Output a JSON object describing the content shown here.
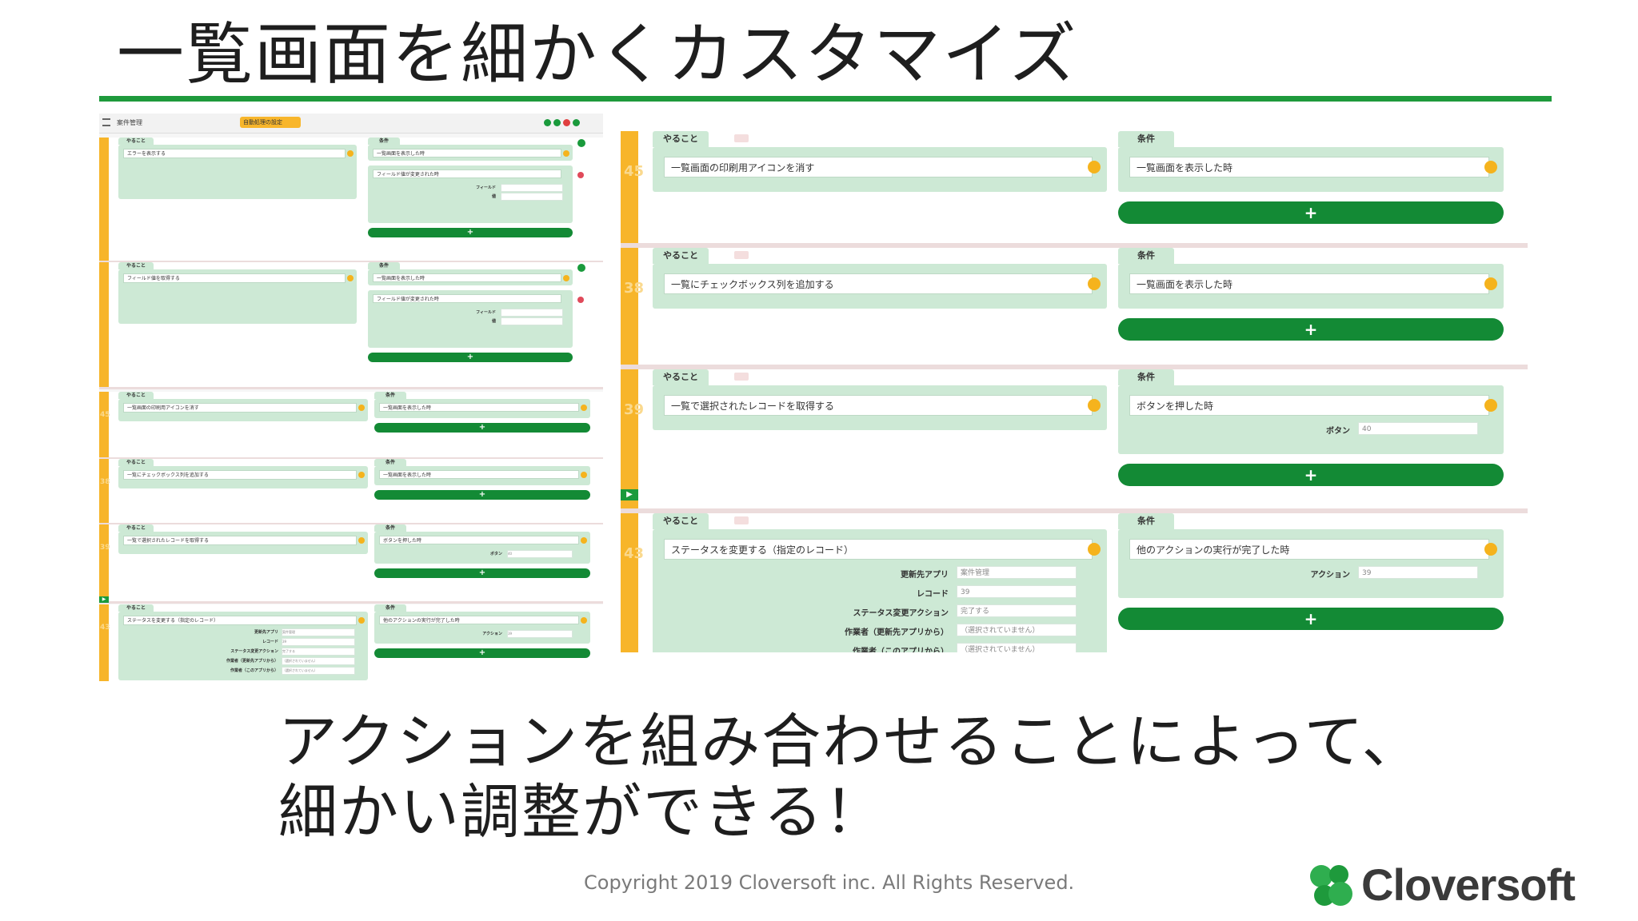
{
  "slide": {
    "title": "一覧画面を細かくカスタマイズ",
    "caption_line1": "アクションを組み合わせることによって、",
    "caption_line2": "細かい調整ができる！",
    "copyright": "Copyright 2019 Cloversoft inc. All Rights Reserved.",
    "brand": "Cloversoft"
  },
  "colors": {
    "accent_green": "#1e9a3c",
    "button_green": "#138a35",
    "card_green": "#cde9d5",
    "row_bar": "#f7b52a"
  },
  "labels": {
    "todo": "やること",
    "condition": "条件",
    "add": "+"
  },
  "large": {
    "rows": [
      {
        "num": "45",
        "action": "一覧画面の印刷用アイコンを消す",
        "condition": "一覧画面を表示した時",
        "action_fields": [],
        "condition_fields": []
      },
      {
        "num": "38",
        "action": "一覧にチェックボックス列を追加する",
        "condition": "一覧画面を表示した時",
        "action_fields": [],
        "condition_fields": []
      },
      {
        "num": "39",
        "action": "一覧で選択されたレコードを取得する",
        "condition": "ボタンを押した時",
        "action_fields": [],
        "condition_fields": [
          {
            "label": "ボタン",
            "value": "40"
          }
        ]
      },
      {
        "num": "43",
        "action": "ステータスを変更する（指定のレコード）",
        "condition": "他のアクションの実行が完了した時",
        "action_fields": [
          {
            "label": "更新先アプリ",
            "value": "案件管理"
          },
          {
            "label": "レコード",
            "value": "39"
          },
          {
            "label": "ステータス変更アクション",
            "value": "完了する"
          },
          {
            "label": "作業者（更新先アプリから）",
            "value": "（選択されていません）"
          },
          {
            "label": "作業者（このアプリから）",
            "value": "（選択されていません）"
          }
        ],
        "condition_fields": [
          {
            "label": "アクション",
            "value": "39"
          }
        ]
      }
    ]
  },
  "small": {
    "toolbar": {
      "app_name": "案件管理",
      "menu_button": "自動処理の設定"
    },
    "rows": [
      {
        "num": "",
        "action": "エラーを表示する",
        "condition": "一覧画面を表示した時",
        "condition2": "フィールド値が変更された時",
        "fields": [
          {
            "label": "フィールド",
            "value": ""
          },
          {
            "label": "値",
            "value": ""
          }
        ]
      },
      {
        "num": "",
        "action": "フィールド値を取得する",
        "condition": "一覧画面を表示した時",
        "condition2": "フィールド値が変更された時",
        "fields": [
          {
            "label": "フィールド",
            "value": ""
          },
          {
            "label": "値",
            "value": ""
          }
        ]
      },
      {
        "num": "45",
        "action": "一覧画面の印刷用アイコンを消す",
        "condition": "一覧画面を表示した時"
      },
      {
        "num": "38",
        "action": "一覧にチェックボックス列を追加する",
        "condition": "一覧画面を表示した時"
      },
      {
        "num": "39",
        "action": "一覧で選択されたレコードを取得する",
        "condition": "ボタンを押した時",
        "cfield": {
          "label": "ボタン",
          "value": "40"
        }
      },
      {
        "num": "43",
        "action": "ステータスを変更する（指定のレコード）",
        "condition": "他のアクションの実行が完了した時",
        "cfield": {
          "label": "アクション",
          "value": "39"
        },
        "fields": [
          {
            "label": "更新先アプリ",
            "value": "案件管理"
          },
          {
            "label": "レコード",
            "value": "39"
          },
          {
            "label": "ステータス変更アクション",
            "value": "完了する"
          },
          {
            "label": "作業者（更新先アプリから）",
            "value": "（選択されていません）"
          },
          {
            "label": "作業者（このアプリから）",
            "value": "（選択されていません）"
          }
        ]
      }
    ]
  }
}
